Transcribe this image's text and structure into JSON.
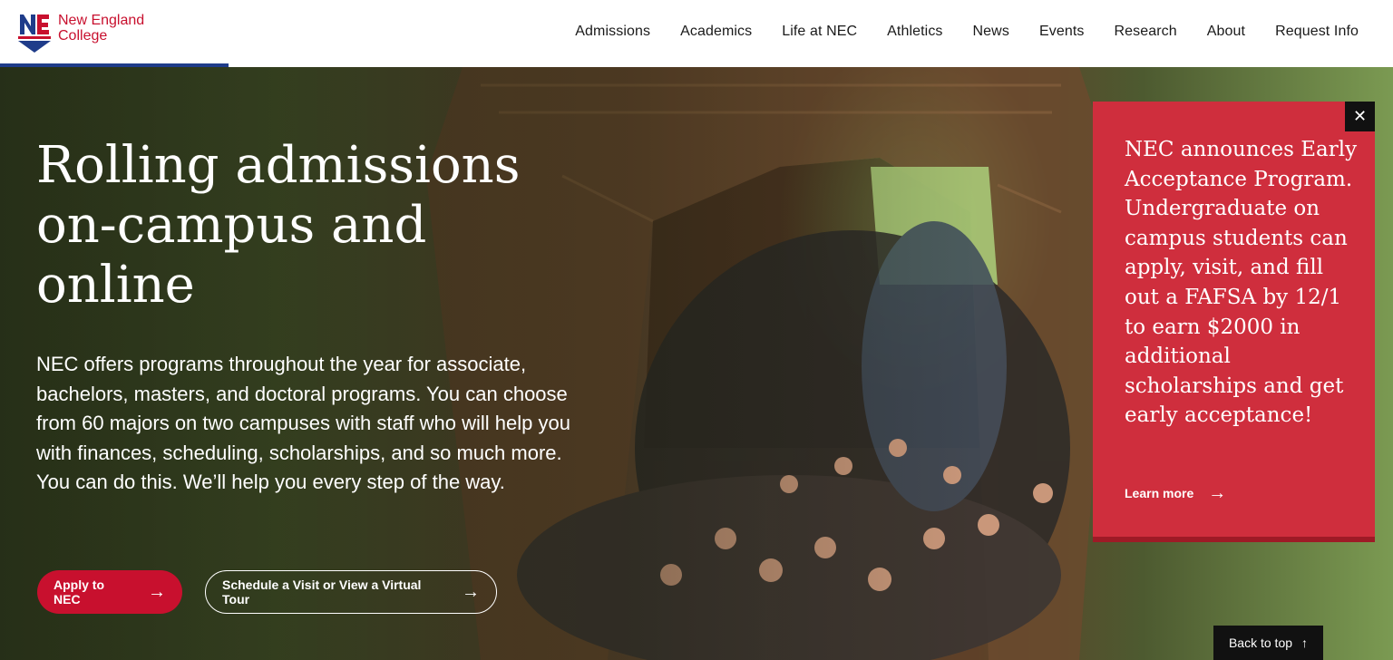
{
  "header": {
    "logo_line1": "New England",
    "logo_line2": "College",
    "nav": [
      "Admissions",
      "Academics",
      "Life at NEC",
      "Athletics",
      "News",
      "Events",
      "Research",
      "About",
      "Request Info"
    ]
  },
  "hero": {
    "title": "Rolling admissions on-campus and online",
    "body": "NEC offers programs throughout the year for associate, bachelors, masters, and doctoral programs. You can choose from 60 majors on two campuses with staff who will help you with finances, scheduling, scholarships, and so much more. You can do this. We’ll help you every step of the way.",
    "apply_label": "Apply to NEC",
    "visit_label": "Schedule a Visit or View a Virtual Tour"
  },
  "panel": {
    "text": "NEC announces Early Acceptance Program. Undergraduate on campus students can apply, visit, and fill out a FAFSA by 12/1 to earn $2000 in additional scholarships and get early acceptance!",
    "link_label": "Learn more"
  },
  "back_to_top": "Back to top",
  "colors": {
    "brand_red": "#c8102e",
    "panel_red": "#cf2e3d",
    "brand_blue": "#1f3c8a"
  },
  "icons": [
    "arrow-right-icon",
    "close-icon",
    "arrow-up-icon"
  ]
}
